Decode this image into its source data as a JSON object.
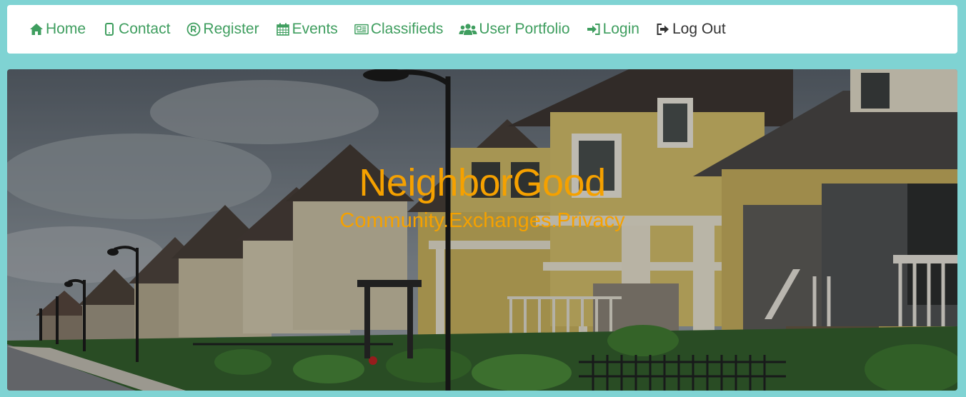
{
  "nav": {
    "items": [
      {
        "label": "Home",
        "icon": "home-icon"
      },
      {
        "label": "Contact",
        "icon": "mobile-icon"
      },
      {
        "label": "Register",
        "icon": "registered-icon"
      },
      {
        "label": "Events",
        "icon": "calendar-icon"
      },
      {
        "label": "Classifieds",
        "icon": "newspaper-icon"
      },
      {
        "label": "User Portfolio",
        "icon": "users-icon"
      },
      {
        "label": "Login",
        "icon": "sign-in-icon"
      },
      {
        "label": "Log Out",
        "icon": "sign-out-icon"
      }
    ]
  },
  "hero": {
    "title": "NeighborGood",
    "subtitle": "Community.Exchanges.Privacy"
  },
  "colors": {
    "page_background": "#7fd3d3",
    "nav_link": "#3f9e5f",
    "nav_logout": "#333333",
    "hero_text": "#f5a100"
  }
}
